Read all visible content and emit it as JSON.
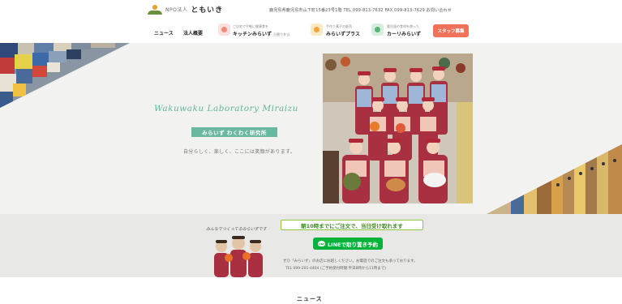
{
  "header": {
    "logo_sub": "NPO法人",
    "logo_main": "ともいき",
    "info": "鹿児島県鹿児島市山下町15番23号1階 TEL 099-813-7632 FAX 099-813-7629 お問い合わせ",
    "nav": {
      "news": "ニュース",
      "about": "法人概要",
      "kitchen_small": "ご自宅で手軽に健康食を",
      "kitchen_big": "キッチンみらいず",
      "kitchen_tag": "日替り弁当",
      "plus_small": "手作り菓子の販売",
      "plus_big": "みらいずプラス",
      "curry_small": "鹿児島の食材を使った",
      "curry_big": "カーリみらいず",
      "staff": "スタッフ募集"
    }
  },
  "hero": {
    "title": "Wakuwaku Laboratory Miraizu",
    "subtitle": "みらいず わくわく研究所",
    "description": "自分らしく、楽しく、ここには笑顔があります。",
    "slide_count": 7,
    "active_slide": 0
  },
  "banner": {
    "mascot_caption": "みんなでつくってるみらいずです",
    "headline": "朝10時までにご注文で、当日受け取れます",
    "line_label": "LINEで取り置き予約",
    "line_icon": "LINE",
    "note1": "ぜひ「みらいず」のお店にお越しください。お電話でのご注文も承っております。",
    "note2": "TEL 099-201-4404 (ご予約受付時間:平日8時から11時まで)"
  },
  "news_title": "ニュース",
  "colors": {
    "accent": "#63b59c",
    "staff_button": "#f07258",
    "line_green": "#06b33a",
    "banner_bg": "#e8e8e6"
  }
}
